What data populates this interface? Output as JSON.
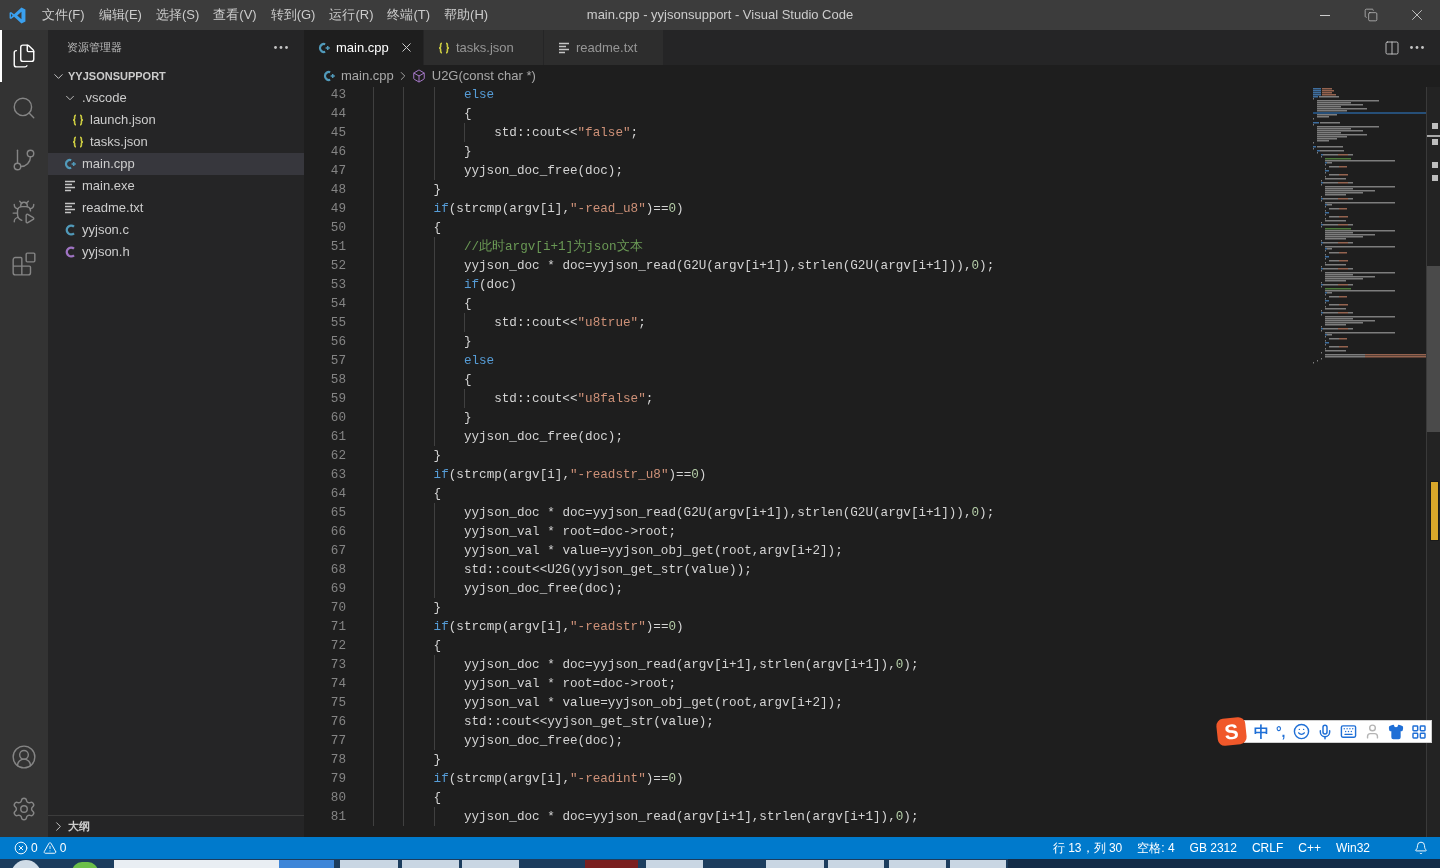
{
  "window": {
    "title": "main.cpp - yyjsonsupport - Visual Studio Code"
  },
  "menu": [
    "文件(F)",
    "编辑(E)",
    "选择(S)",
    "查看(V)",
    "转到(G)",
    "运行(R)",
    "终端(T)",
    "帮助(H)"
  ],
  "activity_bar": {
    "top": [
      {
        "kind": "explorer",
        "selected": true
      },
      {
        "kind": "search",
        "selected": false
      },
      {
        "kind": "source-control",
        "selected": false
      },
      {
        "kind": "run-debug",
        "selected": false
      },
      {
        "kind": "extensions",
        "selected": false
      }
    ],
    "bottom": [
      {
        "kind": "accounts"
      },
      {
        "kind": "manage"
      }
    ]
  },
  "sidebar": {
    "title": "资源管理器",
    "section": {
      "title": "YYJSONSUPPORT",
      "expanded": true
    },
    "items": [
      {
        "kind": "folder",
        "label": ".vscode",
        "expanded": true,
        "selected": false,
        "children": [
          {
            "kind": "json",
            "label": "launch.json",
            "selected": false
          },
          {
            "kind": "json",
            "label": "tasks.json",
            "selected": false
          }
        ]
      },
      {
        "kind": "cpp",
        "label": "main.cpp",
        "selected": true
      },
      {
        "kind": "text",
        "label": "main.exe",
        "selected": false
      },
      {
        "kind": "text",
        "label": "readme.txt",
        "selected": false
      },
      {
        "kind": "c-source",
        "label": "yyjson.c",
        "selected": false
      },
      {
        "kind": "c-header",
        "label": "yyjson.h",
        "selected": false
      }
    ],
    "outline": {
      "title": "大纲",
      "expanded": false
    }
  },
  "tabs": [
    {
      "kind": "cpp",
      "label": "main.cpp",
      "selected": true
    },
    {
      "kind": "json",
      "label": "tasks.json",
      "selected": false
    },
    {
      "kind": "text",
      "label": "readme.txt",
      "selected": false
    }
  ],
  "breadcrumb": [
    {
      "kind": "cpp",
      "label": "main.cpp"
    },
    {
      "kind": "function",
      "label": "U2G(const char *)"
    }
  ],
  "editor": {
    "lines": [
      {
        "number": "43",
        "tokens": [
          {
            "kind": "keyword",
            "text": "            else"
          }
        ]
      },
      {
        "number": "44",
        "tokens": [
          {
            "kind": "plain",
            "text": "            {"
          }
        ]
      },
      {
        "number": "45",
        "tokens": [
          {
            "kind": "plain",
            "text": "                std::cout<<"
          },
          {
            "kind": "string",
            "text": "\"false\""
          },
          {
            "kind": "plain",
            "text": ";"
          }
        ]
      },
      {
        "number": "46",
        "tokens": [
          {
            "kind": "plain",
            "text": "            }"
          }
        ]
      },
      {
        "number": "47",
        "tokens": [
          {
            "kind": "plain",
            "text": "            yyjson_doc_free(doc);"
          }
        ]
      },
      {
        "number": "48",
        "tokens": [
          {
            "kind": "plain",
            "text": "        }"
          }
        ]
      },
      {
        "number": "49",
        "tokens": [
          {
            "kind": "keyword",
            "text": "        if"
          },
          {
            "kind": "plain",
            "text": "(strcmp(argv[i],"
          },
          {
            "kind": "string",
            "text": "\"-read_u8\""
          },
          {
            "kind": "plain",
            "text": ")=="
          },
          {
            "kind": "number",
            "text": "0"
          },
          {
            "kind": "plain",
            "text": ")"
          }
        ]
      },
      {
        "number": "50",
        "tokens": [
          {
            "kind": "plain",
            "text": "        {"
          }
        ]
      },
      {
        "number": "51",
        "tokens": [
          {
            "kind": "comment",
            "text": "            //此时argv[i+1]为json文本"
          }
        ]
      },
      {
        "number": "52",
        "tokens": [
          {
            "kind": "plain",
            "text": "            yyjson_doc * doc=yyjson_read(G2U(argv[i+1]),strlen(G2U(argv[i+1])),"
          },
          {
            "kind": "number",
            "text": "0"
          },
          {
            "kind": "plain",
            "text": ");"
          }
        ]
      },
      {
        "number": "53",
        "tokens": [
          {
            "kind": "keyword",
            "text": "            if"
          },
          {
            "kind": "plain",
            "text": "(doc)"
          }
        ]
      },
      {
        "number": "54",
        "tokens": [
          {
            "kind": "plain",
            "text": "            {"
          }
        ]
      },
      {
        "number": "55",
        "tokens": [
          {
            "kind": "plain",
            "text": "                std::cout<<"
          },
          {
            "kind": "string",
            "text": "\"u8true\""
          },
          {
            "kind": "plain",
            "text": ";"
          }
        ]
      },
      {
        "number": "56",
        "tokens": [
          {
            "kind": "plain",
            "text": "            }"
          }
        ]
      },
      {
        "number": "57",
        "tokens": [
          {
            "kind": "keyword",
            "text": "            else"
          }
        ]
      },
      {
        "number": "58",
        "tokens": [
          {
            "kind": "plain",
            "text": "            {"
          }
        ]
      },
      {
        "number": "59",
        "tokens": [
          {
            "kind": "plain",
            "text": "                std::cout<<"
          },
          {
            "kind": "string",
            "text": "\"u8false\""
          },
          {
            "kind": "plain",
            "text": ";"
          }
        ]
      },
      {
        "number": "60",
        "tokens": [
          {
            "kind": "plain",
            "text": "            }"
          }
        ]
      },
      {
        "number": "61",
        "tokens": [
          {
            "kind": "plain",
            "text": "            yyjson_doc_free(doc);"
          }
        ]
      },
      {
        "number": "62",
        "tokens": [
          {
            "kind": "plain",
            "text": "        }"
          }
        ]
      },
      {
        "number": "63",
        "tokens": [
          {
            "kind": "keyword",
            "text": "        if"
          },
          {
            "kind": "plain",
            "text": "(strcmp(argv[i],"
          },
          {
            "kind": "string",
            "text": "\"-readstr_u8\""
          },
          {
            "kind": "plain",
            "text": ")=="
          },
          {
            "kind": "number",
            "text": "0"
          },
          {
            "kind": "plain",
            "text": ")"
          }
        ]
      },
      {
        "number": "64",
        "tokens": [
          {
            "kind": "plain",
            "text": "        {"
          }
        ]
      },
      {
        "number": "65",
        "tokens": [
          {
            "kind": "plain",
            "text": "            yyjson_doc * doc=yyjson_read(G2U(argv[i+1]),strlen(G2U(argv[i+1])),"
          },
          {
            "kind": "number",
            "text": "0"
          },
          {
            "kind": "plain",
            "text": ");"
          }
        ]
      },
      {
        "number": "66",
        "tokens": [
          {
            "kind": "plain",
            "text": "            yyjson_val * root=doc->root;"
          }
        ]
      },
      {
        "number": "67",
        "tokens": [
          {
            "kind": "plain",
            "text": "            yyjson_val * value=yyjson_obj_get(root,argv[i+2]);"
          }
        ]
      },
      {
        "number": "68",
        "tokens": [
          {
            "kind": "plain",
            "text": "            std::cout<<U2G(yyjson_get_str(value));"
          }
        ]
      },
      {
        "number": "69",
        "tokens": [
          {
            "kind": "plain",
            "text": "            yyjson_doc_free(doc);"
          }
        ]
      },
      {
        "number": "70",
        "tokens": [
          {
            "kind": "plain",
            "text": "        }"
          }
        ]
      },
      {
        "number": "71",
        "tokens": [
          {
            "kind": "keyword",
            "text": "        if"
          },
          {
            "kind": "plain",
            "text": "(strcmp(argv[i],"
          },
          {
            "kind": "string",
            "text": "\"-readstr\""
          },
          {
            "kind": "plain",
            "text": ")=="
          },
          {
            "kind": "number",
            "text": "0"
          },
          {
            "kind": "plain",
            "text": ")"
          }
        ]
      },
      {
        "number": "72",
        "tokens": [
          {
            "kind": "plain",
            "text": "        {"
          }
        ]
      },
      {
        "number": "73",
        "tokens": [
          {
            "kind": "plain",
            "text": "            yyjson_doc * doc=yyjson_read(argv[i+1],strlen(argv[i+1]),"
          },
          {
            "kind": "number",
            "text": "0"
          },
          {
            "kind": "plain",
            "text": ");"
          }
        ]
      },
      {
        "number": "74",
        "tokens": [
          {
            "kind": "plain",
            "text": "            yyjson_val * root=doc->root;"
          }
        ]
      },
      {
        "number": "75",
        "tokens": [
          {
            "kind": "plain",
            "text": "            yyjson_val * value=yyjson_obj_get(root,argv[i+2]);"
          }
        ]
      },
      {
        "number": "76",
        "tokens": [
          {
            "kind": "plain",
            "text": "            std::cout<<yyjson_get_str(value);"
          }
        ]
      },
      {
        "number": "77",
        "tokens": [
          {
            "kind": "plain",
            "text": "            yyjson_doc_free(doc);"
          }
        ]
      },
      {
        "number": "78",
        "tokens": [
          {
            "kind": "plain",
            "text": "        }"
          }
        ]
      },
      {
        "number": "79",
        "tokens": [
          {
            "kind": "keyword",
            "text": "        if"
          },
          {
            "kind": "plain",
            "text": "(strcmp(argv[i],"
          },
          {
            "kind": "string",
            "text": "\"-readint\""
          },
          {
            "kind": "plain",
            "text": ")=="
          },
          {
            "kind": "number",
            "text": "0"
          },
          {
            "kind": "plain",
            "text": ")"
          }
        ]
      },
      {
        "number": "80",
        "tokens": [
          {
            "kind": "plain",
            "text": "        {"
          }
        ]
      },
      {
        "number": "81",
        "tokens": [
          {
            "kind": "plain",
            "text": "            yyjson_doc * doc=yyjson_read(argv[i+1],strlen(argv[i+1]),"
          },
          {
            "kind": "number",
            "text": "0"
          },
          {
            "kind": "plain",
            "text": ");"
          }
        ]
      }
    ]
  },
  "ime_toolbar": {
    "logo": "S",
    "mode": "中",
    "punctuation": "°,"
  },
  "status_bar": {
    "errors": "0",
    "warnings": "0",
    "items": [
      "行 13，列 30",
      "空格: 4",
      "GB 2312",
      "CRLF",
      "C++",
      "Win32"
    ]
  }
}
